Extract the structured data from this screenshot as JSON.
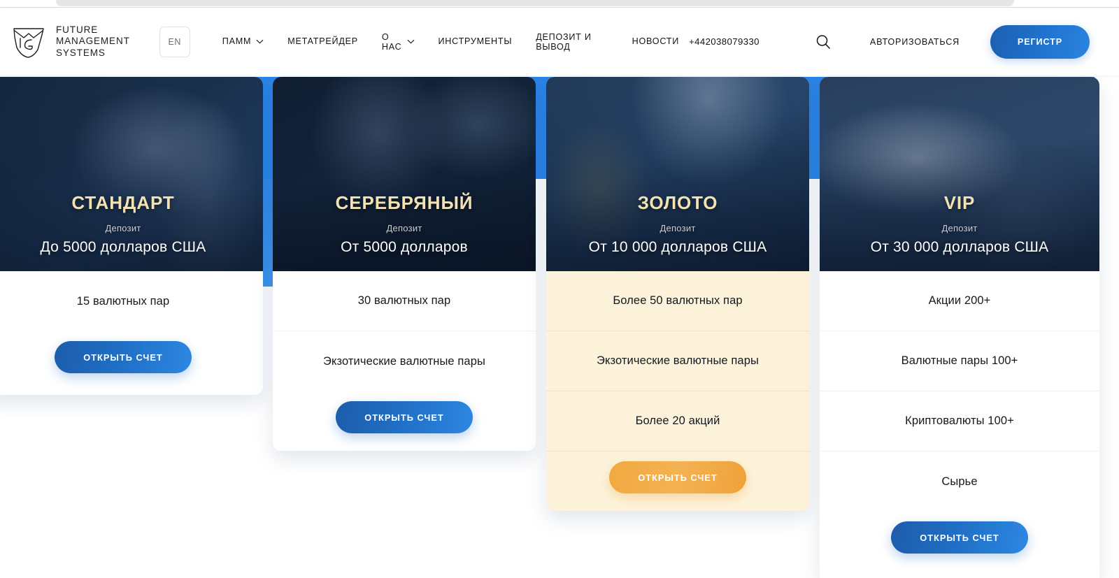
{
  "header": {
    "logo": {
      "icon": "fms-shield-logo",
      "text": "FUTURE\nMANAGEMENT\nSYSTEMS"
    },
    "language_button": {
      "label": "EN"
    },
    "nav": [
      {
        "label": "ПАММ",
        "has_dropdown": true
      },
      {
        "label": "МЕТАТРЕЙДЕР",
        "has_dropdown": false
      },
      {
        "label": "О\nНАС",
        "has_dropdown": true
      },
      {
        "label": "ИНСТРУМЕНТЫ",
        "has_dropdown": false
      },
      {
        "label": "ДЕПОЗИТ И\nВЫВОД",
        "has_dropdown": false
      },
      {
        "label": "НОВОСТИ",
        "has_dropdown": false
      }
    ],
    "phone": "+442038079330",
    "search_icon": "search-icon",
    "auth_link": "АВТОРИЗОВАТЬСЯ",
    "register_button": "РЕГИСТР"
  },
  "colors": {
    "brand_blue": "#2b85e8",
    "button_blue": "#2070c6",
    "gold_accent": "#f1a93f",
    "tier_title_gold": "#f2e2b4",
    "gold_card_bg": "#fdf3db"
  },
  "plans": [
    {
      "name": "СТАНДАРТ",
      "deposit_label": "Депозит",
      "deposit_value": "До 5000 долларов США",
      "photo": "ph-hand",
      "features": [
        "15 валютных пар"
      ],
      "cta": "ОТКРЫТЬ СЧЕТ",
      "highlighted": false
    },
    {
      "name": "СЕРЕБРЯНЫЙ",
      "deposit_label": "Депозит",
      "deposit_value": "От 5000 долларов",
      "photo": "ph-car",
      "features": [
        "30 валютных пар",
        "Экзотические валютные пары"
      ],
      "cta": "ОТКРЫТЬ СЧЕТ",
      "highlighted": false
    },
    {
      "name": "ЗОЛОТО",
      "deposit_label": "Депозит",
      "deposit_value": "От 10 000 долларов США",
      "photo": "ph-suit",
      "features": [
        "Более 50 валютных пар",
        "Экзотические валютные пары",
        "Более 20 акций"
      ],
      "cta": "ОТКРЫТЬ СЧЕТ",
      "highlighted": true
    },
    {
      "name": "VIP",
      "deposit_label": "Депозит",
      "deposit_value": "От 30 000 долларов США",
      "photo": "ph-jet",
      "features": [
        "Акции 200+",
        "Валютные пары 100+",
        "Криптовалюты 100+",
        "Сырье"
      ],
      "cta": "ОТКРЫТЬ СЧЕТ",
      "highlighted": false
    }
  ]
}
